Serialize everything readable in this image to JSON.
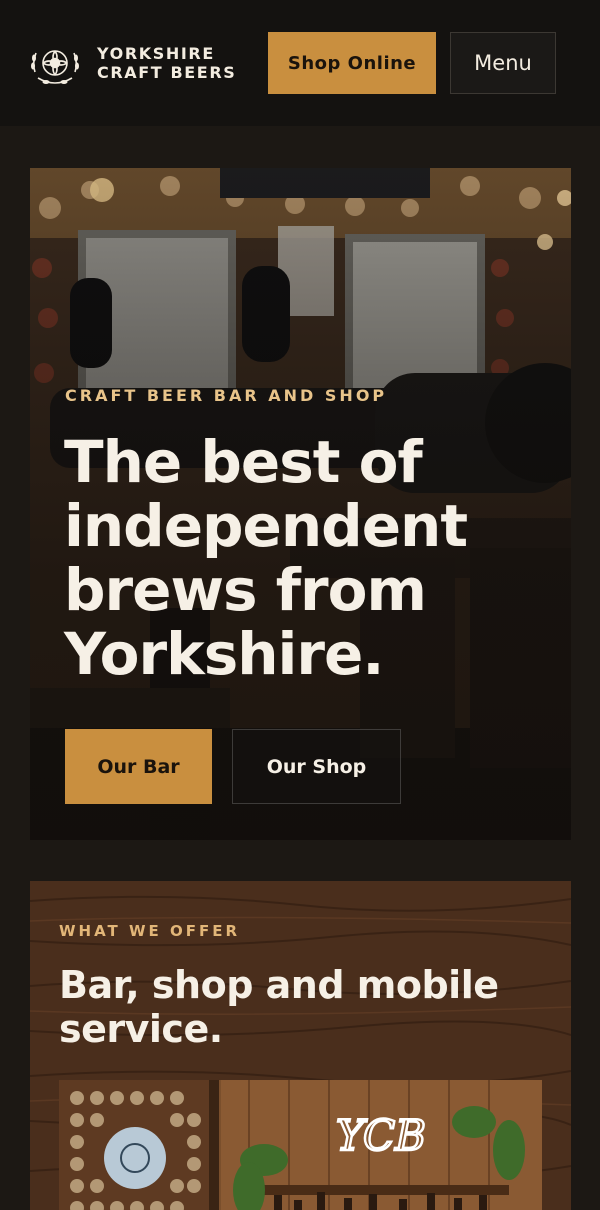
{
  "header": {
    "brand_line1": "YORKSHIRE",
    "brand_line2": "CRAFT BEERS",
    "shop_button": "Shop Online",
    "menu_button": "Menu",
    "icons": [
      "rose-logo-icon"
    ]
  },
  "hero": {
    "eyebrow": "CRAFT BEER BAR AND SHOP",
    "title": "The best of independent brews from Yorkshire.",
    "primary_button": "Our Bar",
    "secondary_button": "Our Shop"
  },
  "offer": {
    "eyebrow": "WHAT WE OFFER",
    "title": "Bar, shop and mobile service.",
    "photo_sign": "YCB"
  },
  "colors": {
    "accent": "#c98f3f",
    "eyebrow": "#e8c48a",
    "header_bg": "#141210",
    "page_bg": "#1c1814",
    "text": "#f3ece0"
  }
}
